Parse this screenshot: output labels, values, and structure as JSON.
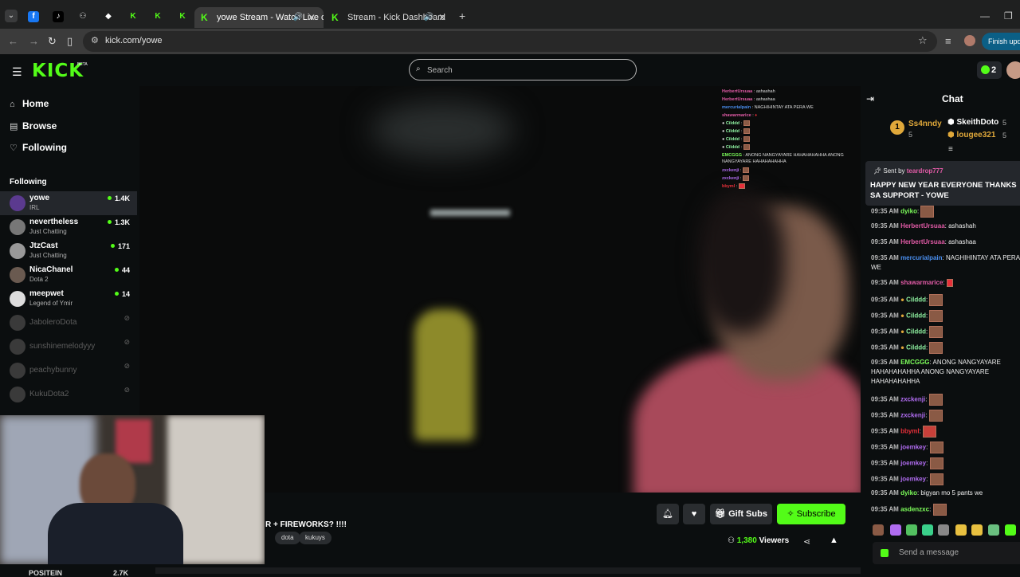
{
  "browser": {
    "tabs": [
      {
        "title": "yowe Stream - Watch Live o"
      },
      {
        "title": "Stream - Kick Dashboard"
      }
    ],
    "url": "kick.com/yowe",
    "update_label": "Finish upda"
  },
  "header": {
    "logo": "KICK",
    "beta": "BETA",
    "search_placeholder": "Search",
    "badge_count": "2"
  },
  "sidebar": {
    "nav": [
      {
        "label": "Home",
        "icon": "home-icon"
      },
      {
        "label": "Browse",
        "icon": "browse-icon"
      },
      {
        "label": "Following",
        "icon": "heart-icon"
      }
    ],
    "following_heading": "Following",
    "channels": [
      {
        "name": "yowe",
        "category": "IRL",
        "viewers": "1.4K"
      },
      {
        "name": "nevertheless",
        "category": "Just Chatting",
        "viewers": "1.3K"
      },
      {
        "name": "JtzCast",
        "category": "Just Chatting",
        "viewers": "171"
      },
      {
        "name": "NicaChanel",
        "category": "Dota 2",
        "viewers": "44"
      },
      {
        "name": "meepwet",
        "category": "Legend of Ymir",
        "viewers": "14"
      },
      {
        "name": "JaboleroDota"
      },
      {
        "name": "sunshinemelodyyy"
      },
      {
        "name": "peachybunny"
      },
      {
        "name": "KukuDota2"
      }
    ],
    "bottom_partial": "POSITEIN",
    "bottom_partial_viewers": "2.7K"
  },
  "stream": {
    "title": "R + FIREWORKS? !!!!",
    "tags": [
      "dota",
      "kukuys"
    ],
    "viewers": "1,380",
    "viewers_label": "Viewers",
    "gift_label": "Gift Subs",
    "subscribe_label": "Subscribe"
  },
  "overlay_chat": [
    {
      "user": "HerbertUrsuaa",
      "text": "ashashah"
    },
    {
      "user": "HerbertUrsuaa",
      "text": "ashashaa"
    },
    {
      "user": "mercurialpain",
      "text": "NAGHIHINTAY ATA PERA WE"
    },
    {
      "user": "shawarmarice",
      "text": ""
    },
    {
      "user": "Cilddd",
      "text": ""
    },
    {
      "user": "Cilddd",
      "text": ""
    },
    {
      "user": "Cilddd",
      "text": ""
    },
    {
      "user": "Cilddd",
      "text": ""
    },
    {
      "user": "EMCGGG",
      "text": "ANONG NANGYAYARE HAHAHAHAHHA ANONG NANGYAYARE HAHAHAHAHHA"
    },
    {
      "user": "zxckenji",
      "text": ""
    },
    {
      "user": "zxckenji",
      "text": ""
    },
    {
      "user": "bbyml",
      "text": ""
    }
  ],
  "chat": {
    "title": "Chat",
    "leaderboard": [
      {
        "rank": "1",
        "name": "Ss4nndy",
        "count": "5"
      },
      {
        "name": "SkeithDoto",
        "count": "5"
      },
      {
        "name": "lougee321",
        "count": "5"
      }
    ],
    "pinned": {
      "sent_by": "Sent by",
      "user": "teardrop777",
      "message": "HAPPY NEW YEAR EVERYONE THANKS SA SUPPORT - YOWE"
    },
    "messages": [
      {
        "time": "09:35 AM",
        "user": "dyiko",
        "color": "#7cfc5a",
        "text": ""
      },
      {
        "time": "09:35 AM",
        "user": "HerbertUrsuaa",
        "color": "#e15ba6",
        "text": "ashashah"
      },
      {
        "time": "09:35 AM",
        "user": "HerbertUrsuaa",
        "color": "#e15ba6",
        "text": "ashashaa"
      },
      {
        "time": "09:35 AM",
        "user": "mercurialpain",
        "color": "#4a8ff0",
        "text": "NAGHIHINTAY ATA PERA WE"
      },
      {
        "time": "09:35 AM",
        "user": "shawarmarice",
        "color": "#e15ba6",
        "text": ""
      },
      {
        "time": "09:35 AM",
        "user": "Cilddd",
        "color": "#8ef0a0",
        "text": ""
      },
      {
        "time": "09:35 AM",
        "user": "Cilddd",
        "color": "#8ef0a0",
        "text": ""
      },
      {
        "time": "09:35 AM",
        "user": "Cilddd",
        "color": "#8ef0a0",
        "text": ""
      },
      {
        "time": "09:35 AM",
        "user": "Cilddd",
        "color": "#8ef0a0",
        "text": ""
      },
      {
        "time": "09:35 AM",
        "user": "EMCGGG",
        "color": "#7cfc5a",
        "text": "ANONG NANGYAYARE HAHAHAHAHHA ANONG NANGYAYARE HAHAHAHAHHA"
      },
      {
        "time": "09:35 AM",
        "user": "zxckenji",
        "color": "#b06cf0",
        "text": ""
      },
      {
        "time": "09:35 AM",
        "user": "zxckenji",
        "color": "#b06cf0",
        "text": ""
      },
      {
        "time": "09:35 AM",
        "user": "bbyml",
        "color": "#e8303a",
        "text": ""
      },
      {
        "time": "09:35 AM",
        "user": "joemkey",
        "color": "#b06cf0",
        "text": ""
      },
      {
        "time": "09:35 AM",
        "user": "joemkey",
        "color": "#b06cf0",
        "text": ""
      },
      {
        "time": "09:35 AM",
        "user": "joemkey",
        "color": "#b06cf0",
        "text": ""
      },
      {
        "time": "09:35 AM",
        "user": "dyiko",
        "color": "#7cfc5a",
        "text": "bigyan mo 5 pants we"
      },
      {
        "time": "09:35 AM",
        "user": "asdenzxc",
        "color": "#7cfc5a",
        "text": ""
      }
    ],
    "send_placeholder": "Send a message"
  },
  "colors": {
    "accent": "#53fc18",
    "bg": "#0b0e0f"
  }
}
